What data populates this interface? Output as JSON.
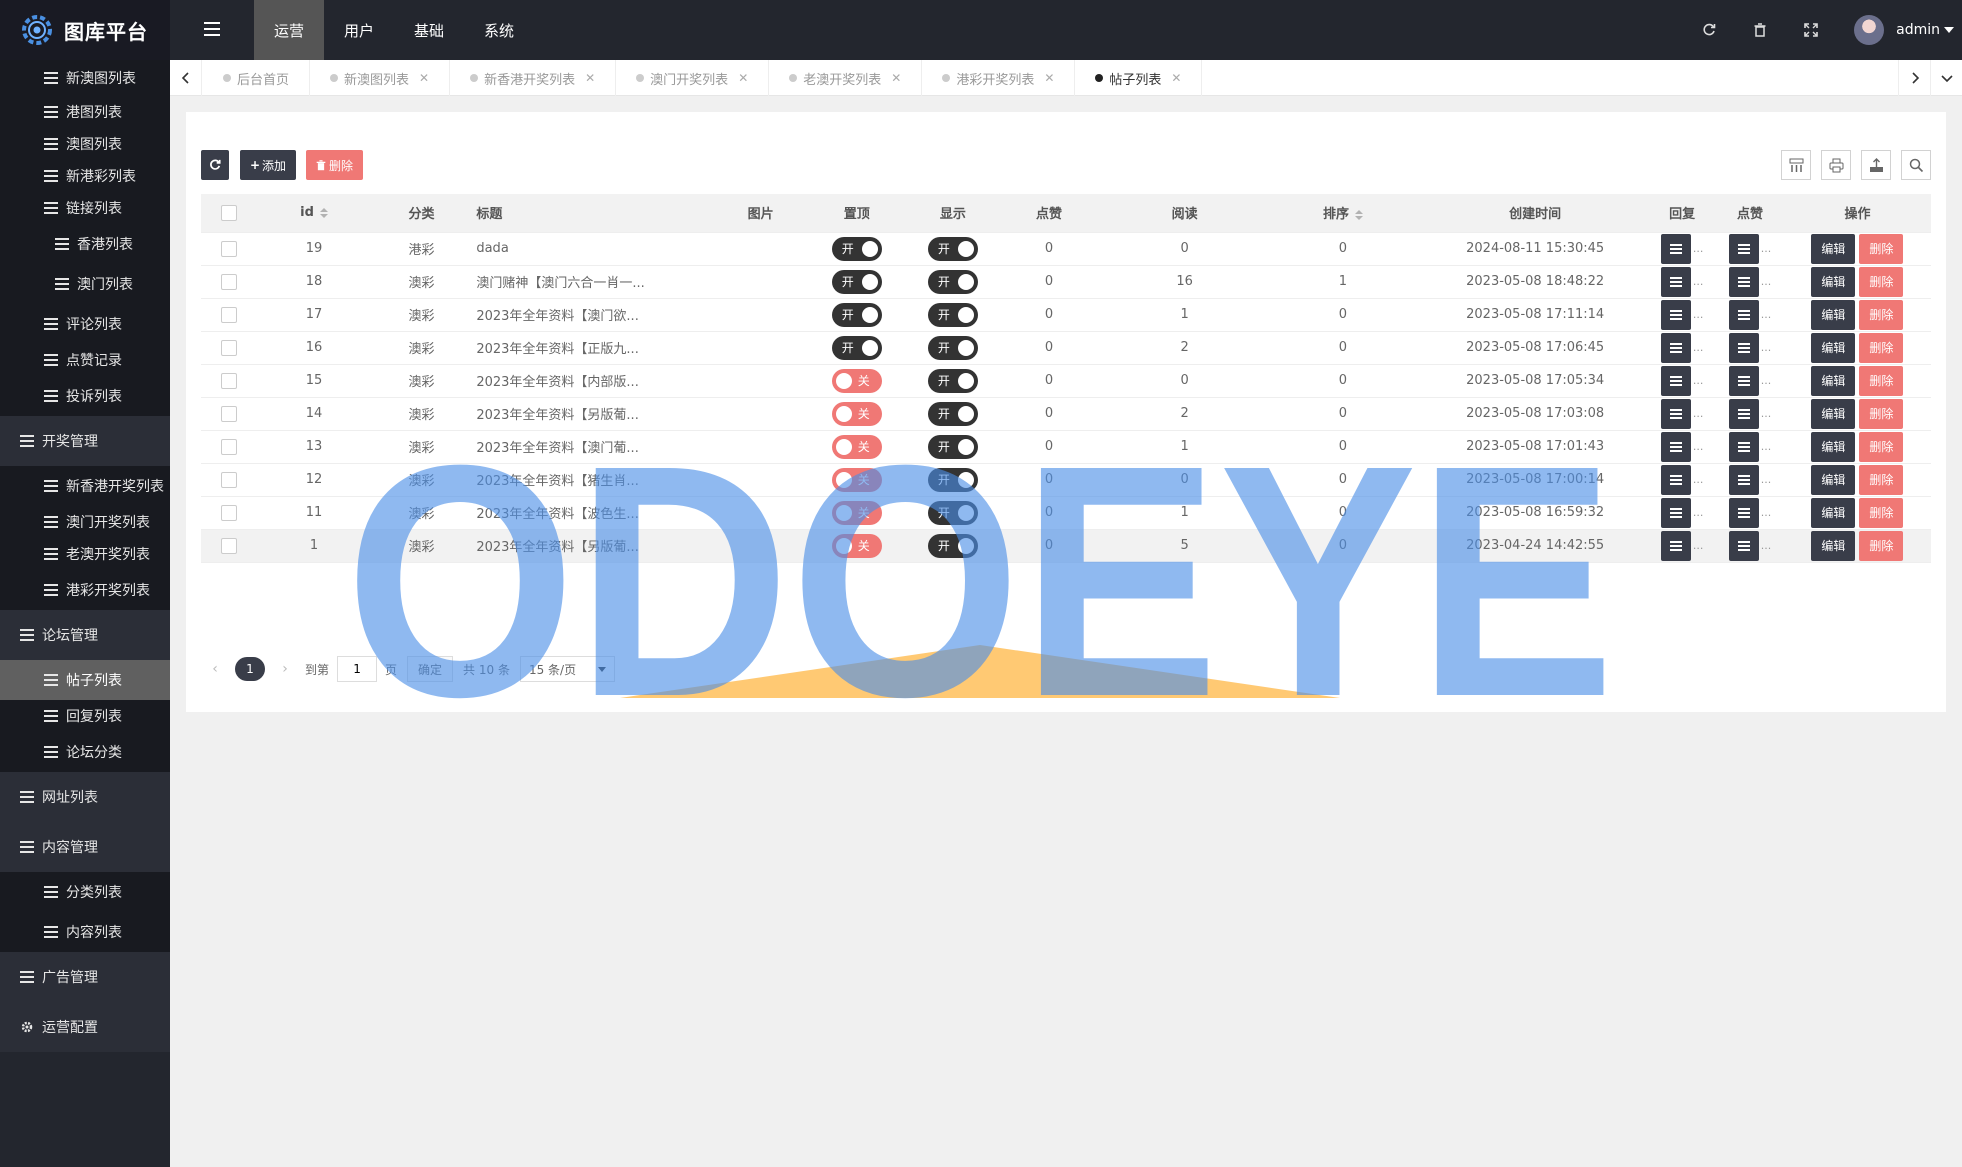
{
  "app": {
    "title": "图库平台",
    "user": "admin"
  },
  "topnav": [
    "运营",
    "用户",
    "基础",
    "系统"
  ],
  "sidebar": [
    {
      "label": "新澳图列表",
      "level": 3
    },
    {
      "label": "港图列表",
      "level": 3
    },
    {
      "label": "澳图列表",
      "level": 3
    },
    {
      "label": "新港彩列表",
      "level": 3
    },
    {
      "label": "链接列表",
      "level": 3
    },
    {
      "label": "香港列表",
      "level": 4
    },
    {
      "label": "澳门列表",
      "level": 4
    },
    {
      "label": "评论列表",
      "level": 2
    },
    {
      "label": "点赞记录",
      "level": 2
    },
    {
      "label": "投诉列表",
      "level": 2
    },
    {
      "label": "开奖管理",
      "level": 1
    },
    {
      "label": "新香港开奖列表",
      "level": 2
    },
    {
      "label": "澳门开奖列表",
      "level": 2
    },
    {
      "label": "老澳开奖列表",
      "level": 2
    },
    {
      "label": "港彩开奖列表",
      "level": 2
    },
    {
      "label": "论坛管理",
      "level": 1
    },
    {
      "label": "帖子列表",
      "level": 2,
      "active": true
    },
    {
      "label": "回复列表",
      "level": 2
    },
    {
      "label": "论坛分类",
      "level": 2
    },
    {
      "label": "网址列表",
      "level": 1
    },
    {
      "label": "内容管理",
      "level": 1
    },
    {
      "label": "分类列表",
      "level": 2
    },
    {
      "label": "内容列表",
      "level": 2
    },
    {
      "label": "广告管理",
      "level": 1
    },
    {
      "label": "运营配置",
      "level": 1,
      "gear": true
    }
  ],
  "tabs": [
    {
      "label": "后台首页",
      "closable": false
    },
    {
      "label": "新澳图列表",
      "closable": true
    },
    {
      "label": "新香港开奖列表",
      "closable": true
    },
    {
      "label": "澳门开奖列表",
      "closable": true
    },
    {
      "label": "老澳开奖列表",
      "closable": true
    },
    {
      "label": "港彩开奖列表",
      "closable": true
    },
    {
      "label": "帖子列表",
      "closable": true,
      "active": true
    }
  ],
  "toolbar": {
    "add": "添加",
    "delete": "删除"
  },
  "table": {
    "headers": [
      "id",
      "分类",
      "标题",
      "图片",
      "置顶",
      "显示",
      "点赞",
      "阅读",
      "排序",
      "创建时间",
      "回复",
      "点赞",
      "操作"
    ],
    "on_label": "开",
    "off_label": "关",
    "edit_label": "编辑",
    "delete_label": "删除",
    "ellipsis": "...",
    "rows": [
      {
        "id": "19",
        "category": "港彩",
        "title": "dada",
        "top": true,
        "show": true,
        "likes": "0",
        "reads": "0",
        "sort": "0",
        "created": "2024-08-11 15:30:45"
      },
      {
        "id": "18",
        "category": "澳彩",
        "title": "澳门赌神【澳门六合一肖一...",
        "top": true,
        "show": true,
        "likes": "0",
        "reads": "16",
        "sort": "1",
        "created": "2023-05-08 18:48:22"
      },
      {
        "id": "17",
        "category": "澳彩",
        "title": "2023年全年资料【澳门欲...",
        "top": true,
        "show": true,
        "likes": "0",
        "reads": "1",
        "sort": "0",
        "created": "2023-05-08 17:11:14"
      },
      {
        "id": "16",
        "category": "澳彩",
        "title": "2023年全年资料【正版九...",
        "top": true,
        "show": true,
        "likes": "0",
        "reads": "2",
        "sort": "0",
        "created": "2023-05-08 17:06:45"
      },
      {
        "id": "15",
        "category": "澳彩",
        "title": "2023年全年资料【内部版...",
        "top": false,
        "show": true,
        "likes": "0",
        "reads": "0",
        "sort": "0",
        "created": "2023-05-08 17:05:34"
      },
      {
        "id": "14",
        "category": "澳彩",
        "title": "2023年全年资料【另版葡...",
        "top": false,
        "show": true,
        "likes": "0",
        "reads": "2",
        "sort": "0",
        "created": "2023-05-08 17:03:08"
      },
      {
        "id": "13",
        "category": "澳彩",
        "title": "2023年全年资料【澳门葡...",
        "top": false,
        "show": true,
        "likes": "0",
        "reads": "1",
        "sort": "0",
        "created": "2023-05-08 17:01:43"
      },
      {
        "id": "12",
        "category": "澳彩",
        "title": "2023年全年资料【猪生肖...",
        "top": false,
        "show": true,
        "likes": "0",
        "reads": "0",
        "sort": "0",
        "created": "2023-05-08 17:00:14"
      },
      {
        "id": "11",
        "category": "澳彩",
        "title": "2023年全年资料【波色生...",
        "top": false,
        "show": true,
        "likes": "0",
        "reads": "1",
        "sort": "0",
        "created": "2023-05-08 16:59:32"
      },
      {
        "id": "1",
        "category": "澳彩",
        "title": "2023年全年资料【另版葡...",
        "top": false,
        "show": true,
        "likes": "0",
        "reads": "5",
        "sort": "0",
        "created": "2023-04-24 14:42:55",
        "highlight": true
      }
    ]
  },
  "pagination": {
    "current": "1",
    "goto_label": "到第",
    "goto_value": "1",
    "page_label": "页",
    "confirm": "确定",
    "total": "共 10 条",
    "per_page": "15 条/页"
  },
  "watermark": {
    "text": "ODOEYE"
  }
}
